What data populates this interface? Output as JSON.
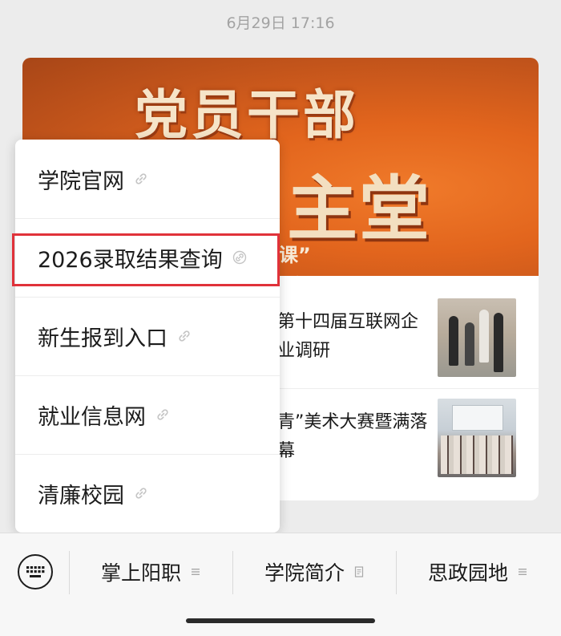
{
  "header": {
    "timestamp": "6月29日 17:16"
  },
  "article": {
    "banner": {
      "title": "党员干部",
      "subtitle": "主堂课”",
      "tail": "课”"
    },
    "news": [
      {
        "text": "第十四届互联网企业调研"
      },
      {
        "text": "青”美术大赛暨满落幕"
      }
    ]
  },
  "menu": {
    "items": [
      {
        "label": "学院官网",
        "icon": "link-icon"
      },
      {
        "label": "2026录取结果查询",
        "icon": "link-icon"
      },
      {
        "label": "新生报到入口",
        "icon": "link-icon"
      },
      {
        "label": "就业信息网",
        "icon": "link-icon"
      },
      {
        "label": "清廉校园",
        "icon": "link-icon"
      }
    ],
    "highlighted_index": 1,
    "highlight_color": "#e0323a"
  },
  "bottom_bar": {
    "keyboard_icon": "keyboard-icon",
    "items": [
      {
        "label": "掌上阳职",
        "icon": "menu-lines-icon"
      },
      {
        "label": "学院简介",
        "icon": "article-icon"
      },
      {
        "label": "思政园地",
        "icon": "menu-lines-icon"
      }
    ]
  },
  "colors": {
    "banner_orange": "#e2651d",
    "background": "#ececec"
  }
}
